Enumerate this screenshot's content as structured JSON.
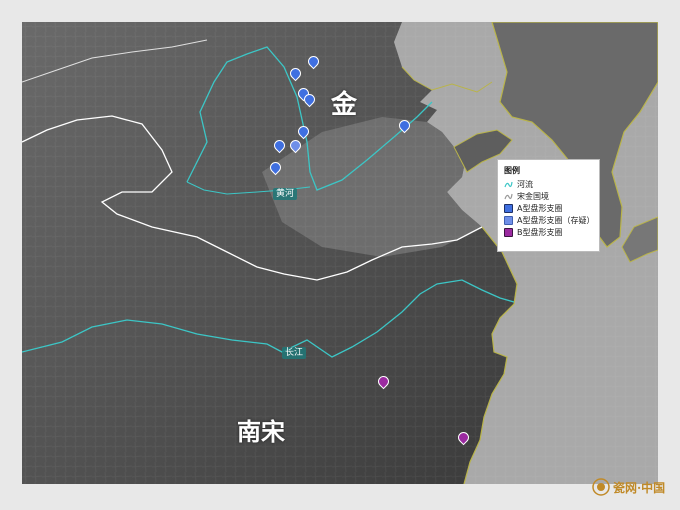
{
  "map": {
    "regions": {
      "jin": "金",
      "southern_song": "南宋"
    },
    "rivers": {
      "yellow_river": "黄河",
      "yangtze": "长江"
    },
    "colors": {
      "land_dark": "#3c3c3c",
      "land_light": "#7d7d7d",
      "sea": "#a7a7a7",
      "river": "#3cc6c6",
      "border": "#ffffff",
      "coast_highlight": "#b9b44a",
      "type_a": "#3f6fe0",
      "type_a_doubt": "#6f8fe8",
      "type_b": "#9b2aa0"
    }
  },
  "legend": {
    "title": "图例",
    "items": [
      {
        "label": "河流",
        "icon": "river-icon"
      },
      {
        "label": "宋金国境",
        "icon": "border-icon"
      },
      {
        "label": "A型盘形支圈",
        "icon": "type-a-icon"
      },
      {
        "label": "A型盘形支圈（存疑）",
        "icon": "type-a-doubt-icon"
      },
      {
        "label": "B型盘形支圈",
        "icon": "type-b-icon"
      }
    ]
  },
  "watermark": {
    "text": "瓷网·中国"
  }
}
